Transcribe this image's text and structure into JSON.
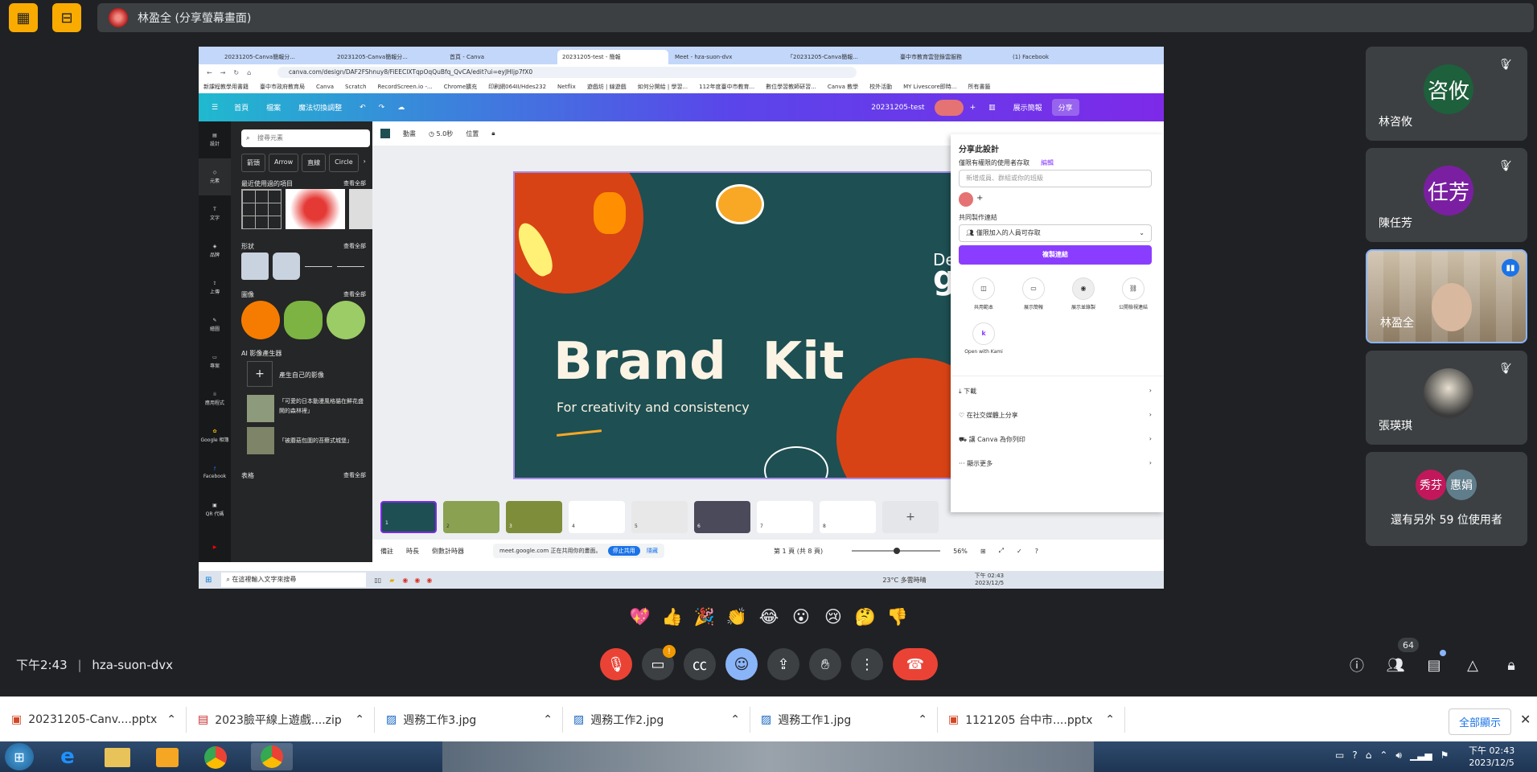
{
  "presenter": {
    "label": "林盈全 (分享螢幕畫面)"
  },
  "meeting": {
    "time": "下午2:43",
    "code": "hza-suon-dvx",
    "participant_count": "64"
  },
  "browser": {
    "tabs": [
      "20231205-Canva簡報分...",
      "20231205-Canva簡報分...",
      "首頁 - Canva",
      "20231205-test - 簡報",
      "Meet - hza-suon-dvx",
      "「20231205-Canva簡報...",
      "臺中市教育雲登錄雲服務",
      "(1) Facebook"
    ],
    "url": "canva.com/design/DAF2FShnuy8/FiEECIXTqpOqQuBfq_QvCA/edit?ui=eyJHIjp7fX0",
    "bookmarks": [
      "新課程教學用書籍",
      "臺中市政府教育局",
      "Canva",
      "Scratch",
      "RecordScreen.io -...",
      "Chrome擴充",
      "印刷網064II/Hdes232",
      "Netflix",
      "遊戲坊 | 線遊戲",
      "如何分開給 | 學習...",
      "112年度臺中市教育...",
      "數位學習教師研習...",
      "Canva 教學",
      "校外活動",
      "MY Livescore即時..."
    ],
    "bookmarks_more": "所有書籤"
  },
  "canva": {
    "menu": [
      "首頁",
      "檔案",
      "魔法切換調整"
    ],
    "doc_title": "20231205-test",
    "present_label": "展示簡報",
    "share_label": "分享",
    "rail": [
      "設計",
      "元素",
      "文字",
      "品牌",
      "上傳",
      "繪圖",
      "專案",
      "應用程式",
      "Google 相簿",
      "Facebook",
      "QR 代碼",
      "YouTube"
    ],
    "search_placeholder": "搜尋元素",
    "chips": [
      "箭頭",
      "Arrow",
      "直線",
      "Circle"
    ],
    "sections": {
      "recent": "最近使用過的項目",
      "shapes": "形狀",
      "graphics": "圖像",
      "ai": "AI 影像產生器",
      "tables": "表格",
      "see_all": "查看全部"
    },
    "ai_items": [
      "產生自己的影像",
      "「可愛的日本動漫風格貓在鮮花盛開的森林裡」",
      "「被蘑菇包圍的苔蘚式城堡」"
    ],
    "toolbar": {
      "animate": "動畫",
      "duration": "5.0秒",
      "position": "位置"
    },
    "slide": {
      "title": "Brand  Kit",
      "subtitle": "For creativity and consistency",
      "side_text1": "De",
      "side_text2": "g"
    },
    "pages": [
      "1",
      "2",
      "3",
      "4",
      "5",
      "6",
      "7",
      "8"
    ],
    "bottom": {
      "notes": "備註",
      "duration": "時長",
      "timer": "倒數計時器",
      "page_info": "第 1 頁 (共 8 頁)",
      "zoom": "56%"
    },
    "meet_bar": {
      "text": "meet.google.com 正在共用你的畫面。",
      "stop": "停止共用",
      "hide": "隱藏"
    }
  },
  "share_panel": {
    "title": "分享此設計",
    "access_label": "僅限有權限的使用者存取",
    "edit_link": "編輯",
    "input_placeholder": "新增成員、群組或你的班級",
    "collab_label": "共同製作連結",
    "collab_value": "僅限加入的人員可存取",
    "copy_button": "複製連結",
    "options": [
      "共用範本",
      "展示簡報",
      "展示並錄製",
      "公開檢視連結"
    ],
    "kami": "Open with Kami",
    "rows": [
      "下載",
      "在社交媒體上分享",
      "讓 Canva 為你列印",
      "顯示更多"
    ]
  },
  "win_taskbar": {
    "search": "在這裡輸入文字來搜尋",
    "weather": "23°C 多雲時晴",
    "time": "下午 02:43",
    "date": "2023/12/5"
  },
  "participants": [
    {
      "name": "林咨攸",
      "avatar": "咨攸",
      "color": "#1e5f3c"
    },
    {
      "name": "陳任芳",
      "avatar": "任芳",
      "color": "#7b1fa2"
    },
    {
      "name": "林盈全",
      "avatar": "",
      "color": ""
    },
    {
      "name": "張瑛琪",
      "avatar": "",
      "color": ""
    }
  ],
  "others": {
    "label": "還有另外 59 位使用者",
    "chips": [
      "秀芬",
      "惠娟"
    ]
  },
  "emojis": [
    "💖",
    "👍",
    "🎉",
    "👏",
    "😂",
    "😮",
    "😢",
    "🤔",
    "👎"
  ],
  "downloads": [
    "20231205-Canv....pptx",
    "2023臉平線上遊戲....zip",
    "週務工作3.jpg",
    "週務工作2.jpg",
    "週務工作1.jpg",
    "1121205 台中市....pptx"
  ],
  "download_show_all": "全部顯示",
  "os_taskbar": {
    "time": "下午 02:43",
    "date": "2023/12/5"
  },
  "colors": {
    "accent": "#8b3dff",
    "meet_red": "#ea4335",
    "canva_bg": "#1e4f52"
  }
}
